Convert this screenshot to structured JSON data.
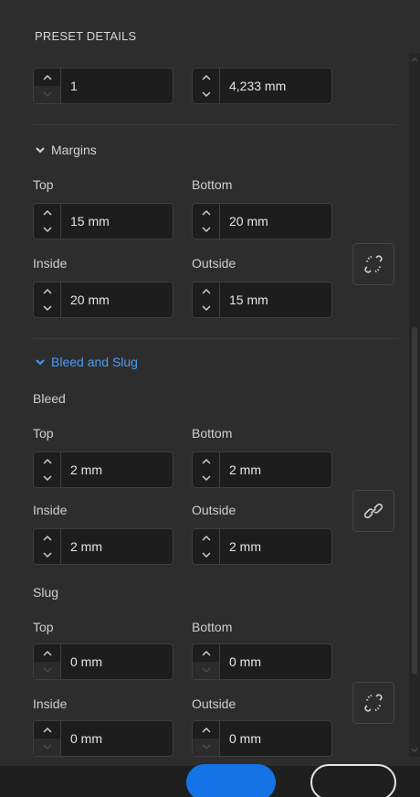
{
  "panel": {
    "title": "PRESET DETAILS"
  },
  "top_row": {
    "columns_value": "1",
    "gutter_value": "4,233 mm"
  },
  "margins": {
    "heading": "Margins",
    "labels": {
      "top": "Top",
      "bottom": "Bottom",
      "inside": "Inside",
      "outside": "Outside"
    },
    "values": {
      "top": "15 mm",
      "bottom": "20 mm",
      "inside": "20 mm",
      "outside": "15 mm"
    },
    "link_state": "unlinked"
  },
  "bleed_slug": {
    "heading": "Bleed and Slug",
    "bleed": {
      "heading": "Bleed",
      "labels": {
        "top": "Top",
        "bottom": "Bottom",
        "inside": "Inside",
        "outside": "Outside"
      },
      "values": {
        "top": "2 mm",
        "bottom": "2 mm",
        "inside": "2 mm",
        "outside": "2 mm"
      },
      "link_state": "linked"
    },
    "slug": {
      "heading": "Slug",
      "labels": {
        "top": "Top",
        "bottom": "Bottom",
        "inside": "Inside",
        "outside": "Outside"
      },
      "values": {
        "top": "0 mm",
        "bottom": "0 mm",
        "inside": "0 mm",
        "outside": "0 mm"
      },
      "link_state": "unlinked"
    }
  },
  "colors": {
    "accent": "#1473e6",
    "link_blue": "#4b9cf5",
    "panel_bg": "#2d2d2d",
    "field_bg": "#1d1d1d"
  }
}
